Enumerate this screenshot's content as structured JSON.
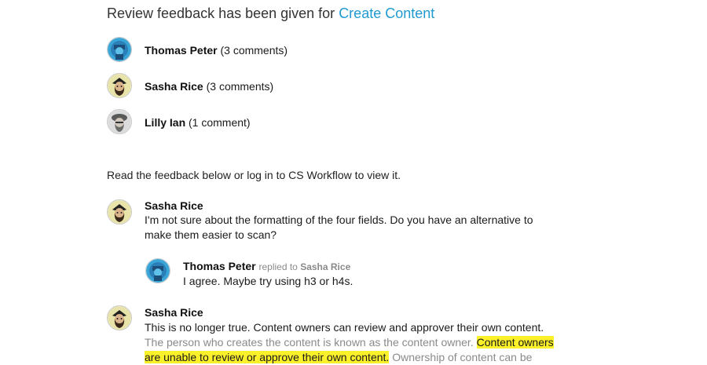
{
  "headline": {
    "prefix": "Review feedback has been given for ",
    "link": "Create Content"
  },
  "reviewers": [
    {
      "name": "Thomas Peter",
      "count": "(3 comments)"
    },
    {
      "name": "Sasha Rice",
      "count": "(3 comments)"
    },
    {
      "name": "Lilly Ian",
      "count": "(1 comment)"
    }
  ],
  "intro": "Read the feedback below or log in to CS Workflow to view it.",
  "comments": [
    {
      "author": "Sasha Rice",
      "body": "I'm not sure about the formatting of the four fields. Do you have an alternative to make them easier to scan?"
    },
    {
      "author": "Thomas Peter",
      "replied_to": "replied to",
      "replied_name": "Sasha Rice",
      "body": "I agree. Maybe try using h3 or h4s."
    },
    {
      "author": "Sasha Rice",
      "body_main": "This is no longer true. Content owners can review and approver their own content.",
      "body_muted": "The person who creates the content is known as the content owner.",
      "body_highlight": "Content owners are unable to review or approve their own content.",
      "body_muted_end": "Ownership of content can be"
    }
  ],
  "colors": {
    "link": "#1f9ad1",
    "highlight": "#fbf12a",
    "muted": "#8a8a8a"
  }
}
